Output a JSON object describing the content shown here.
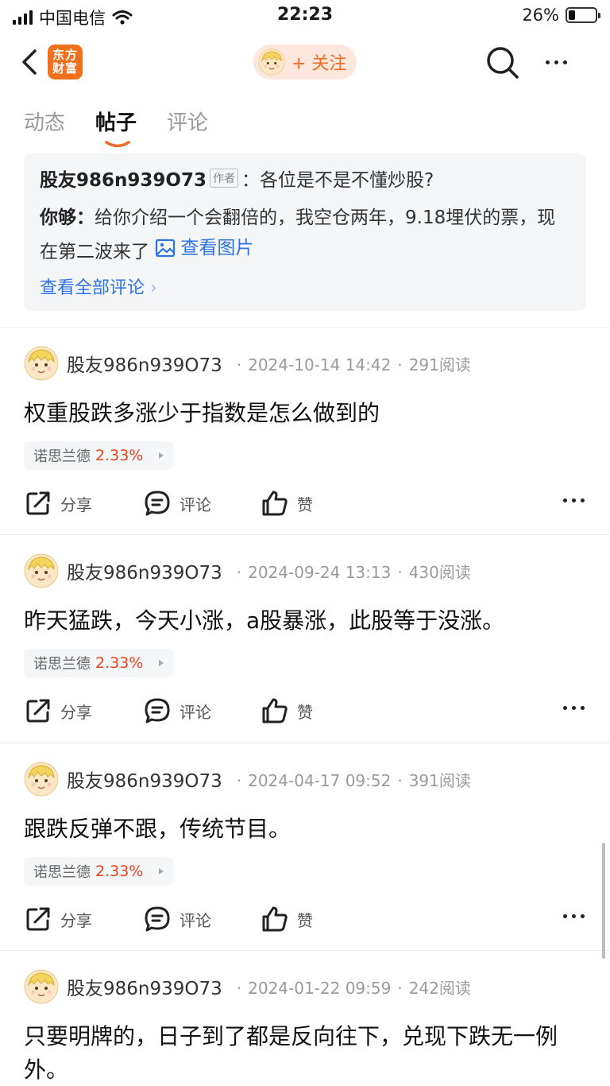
{
  "status_bar": {
    "carrier": "中国电信",
    "time": "22:23",
    "battery": "26%",
    "battery_level": 0.26
  },
  "nav": {
    "logo_line1": "东方",
    "logo_line2": "财富",
    "follow_label": "+ 关注",
    "brand_color": "#f06a23"
  },
  "tabs": [
    {
      "label": "动态"
    },
    {
      "label": "帖子",
      "active": true
    },
    {
      "label": "评论"
    }
  ],
  "pinned": {
    "author": "股友986n939O73",
    "author_tag": "作者",
    "colon": "：",
    "question": "各位是不是不懂炒股?",
    "reply_user": "你够：",
    "reply_text": "给你介绍一个会翻倍的，我空仓两年，9.18埋伏的票，现在第二波来了",
    "view_image": "查看图片",
    "view_all": "查看全部评论"
  },
  "action_labels": {
    "share": "分享",
    "comment": "评论",
    "like": "赞"
  },
  "posts": [
    {
      "author": "股友986n939O73",
      "date": "2024-10-14 14:42",
      "reads": "291阅读",
      "body": "权重股跌多涨少于指数是怎么做到的",
      "stock": "诺思兰德",
      "pct": "2.33%"
    },
    {
      "author": "股友986n939O73",
      "date": "2024-09-24 13:13",
      "reads": "430阅读",
      "body": "昨天猛跌，今天小涨，a股暴涨，此股等于没涨。",
      "stock": "诺思兰德",
      "pct": "2.33%"
    },
    {
      "author": "股友986n939O73",
      "date": "2024-04-17 09:52",
      "reads": "391阅读",
      "body": "跟跌反弹不跟，传统节目。",
      "stock": "诺思兰德",
      "pct": "2.33%"
    },
    {
      "author": "股友986n939O73",
      "date": "2024-01-22 09:59",
      "reads": "242阅读",
      "body": "只要明牌的，日子到了都是反向往下，兑现下跌无一例外。"
    }
  ]
}
